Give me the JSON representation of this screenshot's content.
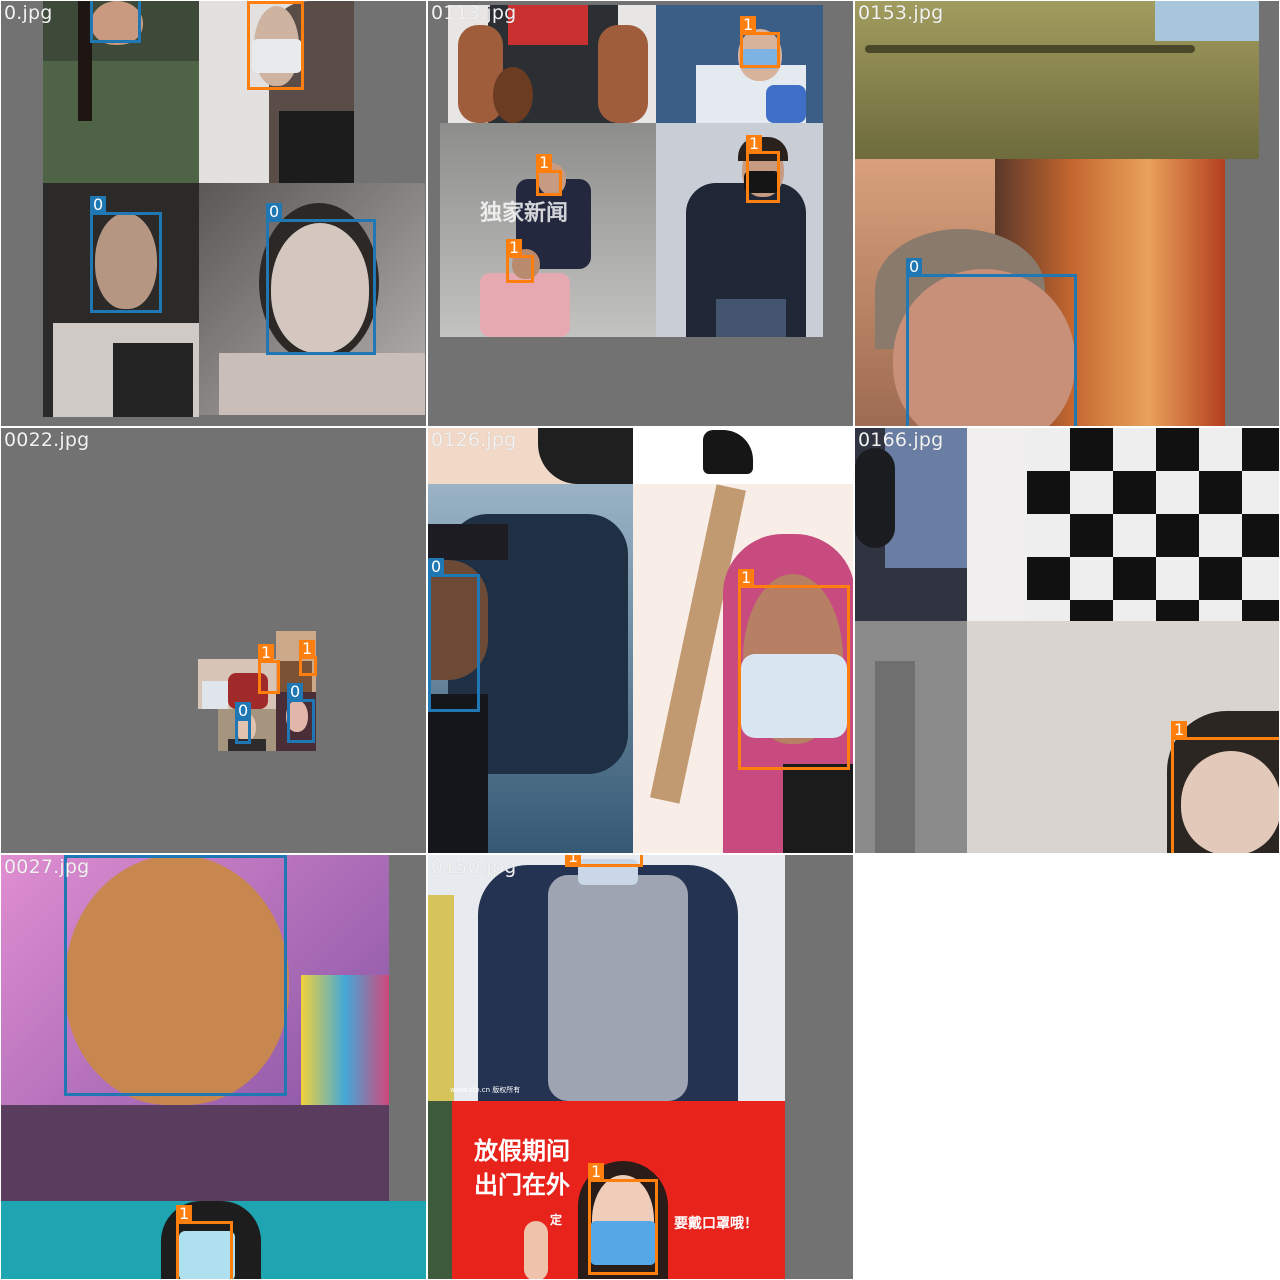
{
  "tiles": [
    {
      "label": "0.jpg",
      "boxes": [
        {
          "cls": "0"
        },
        {
          "cls": "1"
        },
        {
          "cls": "0"
        },
        {
          "cls": "0"
        }
      ]
    },
    {
      "label": "0113.jpg",
      "boxes": [
        {
          "cls": "1"
        },
        {
          "cls": "1"
        },
        {
          "cls": "1"
        },
        {
          "cls": "1"
        }
      ]
    },
    {
      "label": "0153.jpg",
      "boxes": [
        {
          "cls": "0"
        }
      ]
    },
    {
      "label": "0022.jpg",
      "boxes": [
        {
          "cls": "1"
        },
        {
          "cls": "1"
        },
        {
          "cls": "0"
        },
        {
          "cls": "0"
        }
      ]
    },
    {
      "label": "0126.jpg",
      "boxes": [
        {
          "cls": "0"
        },
        {
          "cls": "1"
        }
      ]
    },
    {
      "label": "0166.jpg",
      "boxes": [
        {
          "cls": "1"
        }
      ]
    },
    {
      "label": "0027.jpg",
      "boxes": [
        {
          "cls": "0"
        },
        {
          "cls": "1"
        }
      ]
    },
    {
      "label": "0150.jpg",
      "boxes": [
        {
          "cls": "1"
        },
        {
          "cls": "1"
        }
      ]
    }
  ],
  "sign_text": {
    "line1": "放假期间",
    "line2": "出门在外",
    "side": "要戴口罩哦！",
    "left": "定"
  },
  "watermark": {
    "tile2": "独家新闻",
    "tile8": "cfp",
    "tile8_text": "www.cfp.cn 版权所有"
  },
  "colors": {
    "class0": "#1f77b4",
    "class1": "#ff7f0e",
    "pad": "#727272"
  }
}
